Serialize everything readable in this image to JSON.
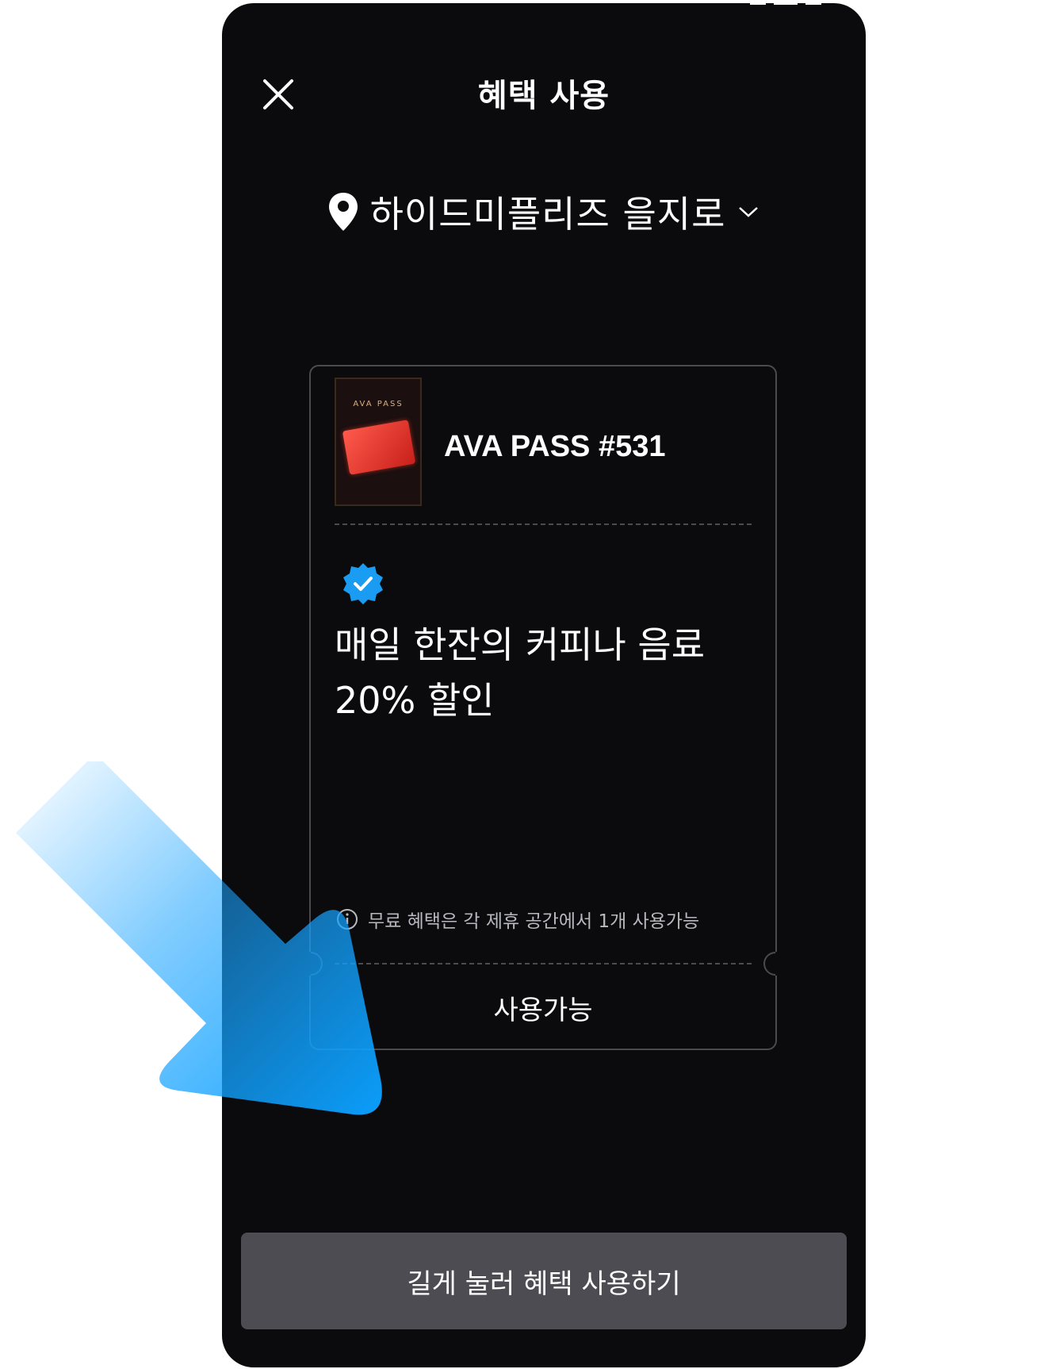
{
  "header": {
    "title": "혜택 사용"
  },
  "location": {
    "name": "하이드미플리즈 을지로"
  },
  "card": {
    "thumbnail_label": "AVA PASS",
    "title": "AVA PASS #531",
    "benefit": "매일 한잔의 커피나 음료\n20% 할인",
    "notice": "무료 혜택은 각 제휴 공간에서 1개 사용가능",
    "status": "사용가능"
  },
  "cta": {
    "label": "길게 눌러 혜택 사용하기"
  },
  "colors": {
    "background": "#0b0b0e",
    "accent": "#1a9cf2",
    "button": "#4c4c52"
  }
}
